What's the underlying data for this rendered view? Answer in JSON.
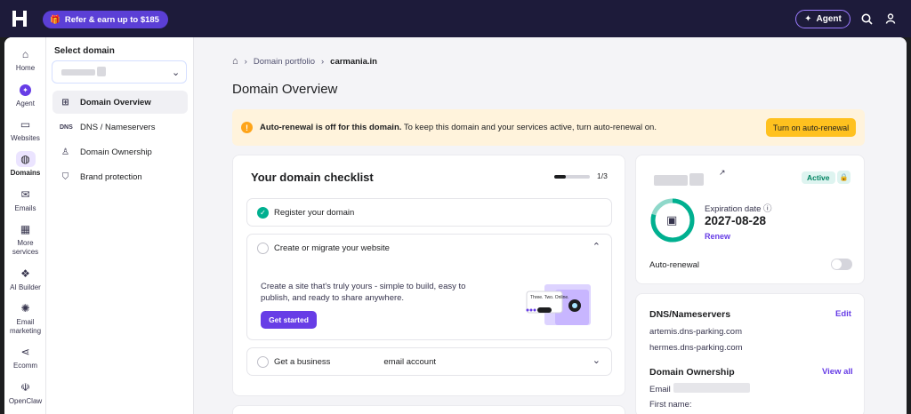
{
  "topbar": {
    "refer_label": "Refer & earn up to $185",
    "agent_label": "Agent"
  },
  "rail": {
    "items": [
      {
        "label": "Home",
        "icon": "home-icon"
      },
      {
        "label": "Agent",
        "icon": "agent-icon"
      },
      {
        "label": "Websites",
        "icon": "websites-icon"
      },
      {
        "label": "Domains",
        "icon": "globe-icon"
      },
      {
        "label": "Emails",
        "icon": "mail-icon"
      },
      {
        "label": "More services",
        "icon": "store-icon"
      },
      {
        "label": "AI Builder",
        "icon": "ai-builder-icon"
      },
      {
        "label": "Email marketing",
        "icon": "email-marketing-icon"
      },
      {
        "label": "Ecomm",
        "icon": "share-icon"
      },
      {
        "label": "OpenClaw",
        "icon": "openclaw-icon"
      }
    ]
  },
  "subnav": {
    "title": "Select domain",
    "items": [
      {
        "label": "Domain Overview"
      },
      {
        "label": "DNS / Nameservers"
      },
      {
        "label": "Domain Ownership"
      },
      {
        "label": "Brand protection"
      }
    ]
  },
  "breadcrumb": {
    "portfolio": "Domain portfolio",
    "current": "carmania.in"
  },
  "page": {
    "title": "Domain Overview"
  },
  "banner": {
    "bold": "Auto-renewal is off for this domain.",
    "text": " To keep this domain and your services active, turn auto-renewal on.",
    "button": "Turn on auto-renewal"
  },
  "checklist": {
    "title": "Your domain checklist",
    "progress_text": "1/3",
    "progress_fraction": 0.33,
    "steps": [
      {
        "title": "Register your domain"
      },
      {
        "title": "Create or migrate your website",
        "description": "Create a site that's truly yours - simple to build, easy to publish, and ready to share anywhere.",
        "button": "Get started"
      },
      {
        "title_start": "Get a business",
        "title_end": "email account"
      }
    ],
    "illustration_text": "Three. Two. Online."
  },
  "domain_card": {
    "status": "Active",
    "expiration_label": "Expiration date",
    "expiration_date": "2027-08-28",
    "renew_label": "Renew",
    "auto_renewal_label": "Auto-renewal"
  },
  "dns_card": {
    "title": "DNS/Nameservers",
    "edit_label": "Edit",
    "nameservers": [
      "artemis.dns-parking.com",
      "hermes.dns-parking.com"
    ],
    "ownership_title": "Domain Ownership",
    "view_all_label": "View all",
    "email_label": "Email",
    "first_name_label": "First name:"
  }
}
